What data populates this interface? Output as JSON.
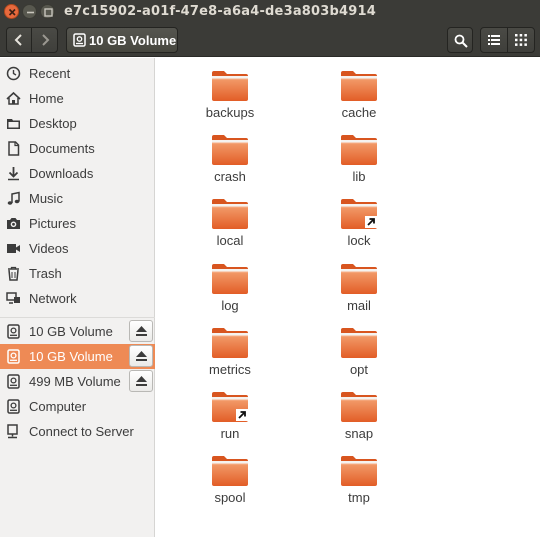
{
  "window": {
    "title": "e7c15902-a01f-47e8-a6a4-de3a803b4914"
  },
  "toolbar": {
    "path_label": "10 GB Volume",
    "icons": {
      "back": "chevron-left-icon",
      "forward": "chevron-right-icon",
      "search": "search-icon",
      "list_view": "list-view-icon",
      "grid_view": "grid-view-icon"
    }
  },
  "sidebar": {
    "places": [
      {
        "label": "Recent",
        "icon": "clock-icon"
      },
      {
        "label": "Home",
        "icon": "home-icon"
      },
      {
        "label": "Desktop",
        "icon": "folder-icon"
      },
      {
        "label": "Documents",
        "icon": "document-icon"
      },
      {
        "label": "Downloads",
        "icon": "download-icon"
      },
      {
        "label": "Music",
        "icon": "music-icon"
      },
      {
        "label": "Pictures",
        "icon": "camera-icon"
      },
      {
        "label": "Videos",
        "icon": "video-icon"
      },
      {
        "label": "Trash",
        "icon": "trash-icon"
      },
      {
        "label": "Network",
        "icon": "network-icon"
      }
    ],
    "devices": [
      {
        "label": "10 GB Volume",
        "icon": "drive-icon",
        "eject": true,
        "selected": false
      },
      {
        "label": "10 GB Volume",
        "icon": "drive-icon",
        "eject": true,
        "selected": true
      },
      {
        "label": "499 MB Volume",
        "icon": "drive-icon",
        "eject": true,
        "selected": false
      },
      {
        "label": "Computer",
        "icon": "drive-icon",
        "eject": false,
        "selected": false
      },
      {
        "label": "Connect to Server",
        "icon": "server-icon",
        "eject": false,
        "selected": false
      }
    ]
  },
  "files": [
    {
      "name": "backups",
      "link": false
    },
    {
      "name": "cache",
      "link": false
    },
    {
      "name": "crash",
      "link": false
    },
    {
      "name": "lib",
      "link": false
    },
    {
      "name": "local",
      "link": false
    },
    {
      "name": "lock",
      "link": true
    },
    {
      "name": "log",
      "link": false
    },
    {
      "name": "mail",
      "link": false
    },
    {
      "name": "metrics",
      "link": false
    },
    {
      "name": "opt",
      "link": false
    },
    {
      "name": "run",
      "link": true
    },
    {
      "name": "snap",
      "link": false
    },
    {
      "name": "spool",
      "link": false
    },
    {
      "name": "tmp",
      "link": false
    }
  ],
  "colors": {
    "accent": "#ee8a55",
    "folder_light": "#f4a67a",
    "folder_dark": "#e0622c",
    "titlebar": "#3b3b37",
    "close_button": "#e7693d"
  }
}
